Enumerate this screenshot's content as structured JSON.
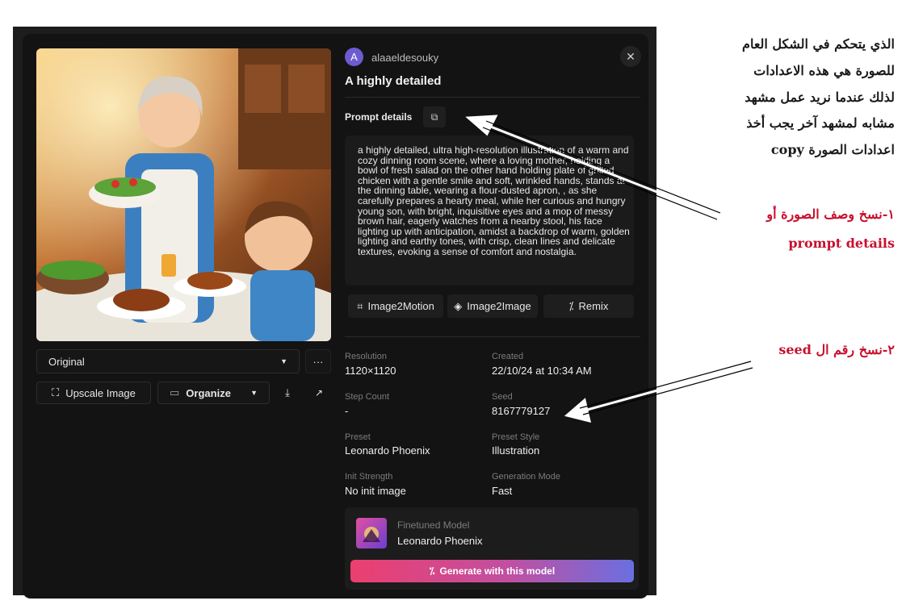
{
  "header": {
    "username": "alaaeldesouky",
    "avatar_letter": "A",
    "title": "A highly detailed"
  },
  "prompt": {
    "heading": "Prompt details",
    "text": "a highly detailed, ultra high-resolution illustration of a warm and cozy dinning room scene, where a loving mother, holding a bowl of fresh salad on the other hand holding plate of grilled chicken with a gentle smile and soft, wrinkled hands, stands at the dinning table, wearing a flour-dusted apron, , as she carefully prepares a hearty meal, while her curious and hungry young son, with bright, inquisitive eyes and a mop of messy brown hair, eagerly watches from a nearby stool, his face lighting up with anticipation, amidst a backdrop of warm, golden lighting and earthy tones, with crisp, clean lines and delicate textures, evoking a sense of comfort and nostalgia."
  },
  "actions": {
    "image2motion": "Image2Motion",
    "image2image": "Image2Image",
    "remix": "Remix"
  },
  "left_controls": {
    "dropdown_value": "Original",
    "more": "···",
    "upscale": "Upscale Image",
    "organize": "Organize"
  },
  "details": {
    "resolution_label": "Resolution",
    "resolution": "1120×1120",
    "created_label": "Created",
    "created": "22/10/24 at 10:34 AM",
    "step_label": "Step Count",
    "step": "-",
    "seed_label": "Seed",
    "seed": "8167779127",
    "preset_label": "Preset",
    "preset": "Leonardo Phoenix",
    "preset_style_label": "Preset Style",
    "preset_style": "Illustration",
    "init_label": "Init Strength",
    "init": "No init image",
    "gen_mode_label": "Generation Mode",
    "gen_mode": "Fast"
  },
  "model": {
    "label": "Finetuned Model",
    "name": "Leonardo Phoenix",
    "generate": "Generate with this model"
  },
  "annotations": {
    "note_lines": [
      "الذي يتحكم في الشكل العام",
      "للصورة هي هذه الاعدادات",
      "لذلك عندما نريد عمل مشهد",
      "مشابه لمشهد آخر يجب أخذ",
      "اعدادات الصورة copy"
    ],
    "step1_line1": "١-نسخ وصف الصورة أو",
    "step1_line2": "prompt details",
    "step2": "٢-نسخ رقم ال seed"
  },
  "colors": {
    "accent_red": "#c8102e",
    "gradient_start": "#ec3f6f",
    "gradient_end": "#6a6fe0",
    "avatar": "#6d5bd0"
  }
}
